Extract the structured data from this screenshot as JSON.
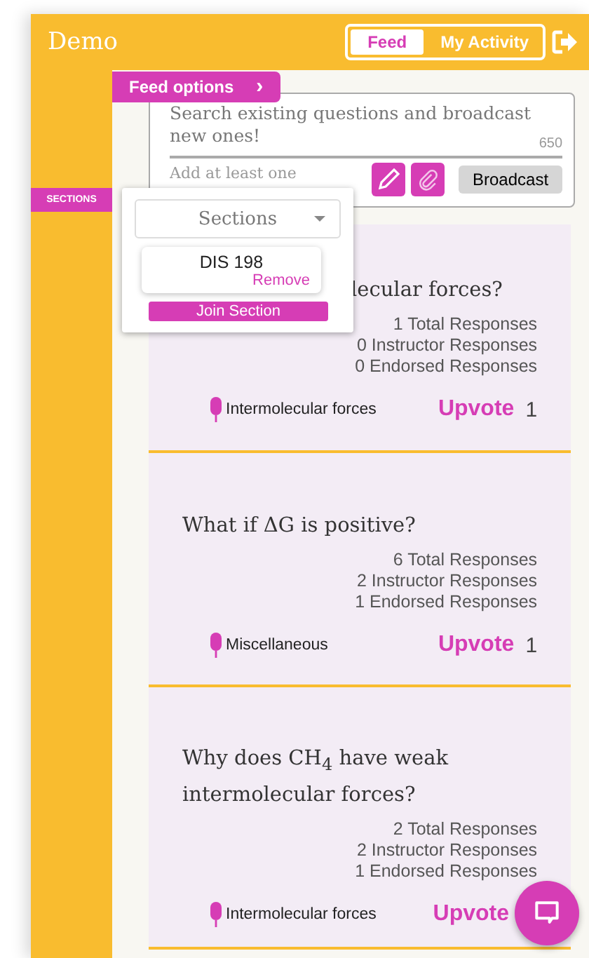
{
  "header": {
    "title": "Demo",
    "tabs": [
      {
        "label": "Feed",
        "selected": true
      },
      {
        "label": "My Activity",
        "selected": false
      }
    ]
  },
  "sidebar": {
    "sections_tag": "SECTIONS"
  },
  "feed_options": {
    "label": "Feed options",
    "arrow": "›"
  },
  "composer": {
    "placeholder": "Search existing questions and broadcast new ones!",
    "counter": "650",
    "topic_placeholder": "Add at least one",
    "button": "Broadcast"
  },
  "sections_popup": {
    "dropdown": "Sections",
    "sections": [
      {
        "name": "DIS 198",
        "action": "Remove"
      }
    ],
    "join_button": "Join Section"
  },
  "questions": [
    {
      "title": "lecular forces?",
      "covered": true,
      "stats": [
        "1 Total Responses",
        "0 Instructor Responses",
        "0 Endorsed Responses"
      ],
      "topic": "Intermolecular forces",
      "upvote": "Upvote",
      "count": "1"
    },
    {
      "title": "What if ΔG is positive?",
      "covered": false,
      "stats": [
        "6 Total Responses",
        "2 Instructor Responses",
        "1 Endorsed Responses"
      ],
      "topic": "Miscellaneous",
      "upvote": "Upvote",
      "count": "1"
    },
    {
      "title": "Why does CH$_{4}$ have weak intermolecular forces?",
      "covered": false,
      "stats": [
        "2 Total Responses",
        "2 Instructor Responses",
        "1 Endorsed Responses"
      ],
      "topic": "Intermolecular forces",
      "upvote": "Upvote"
    }
  ]
}
